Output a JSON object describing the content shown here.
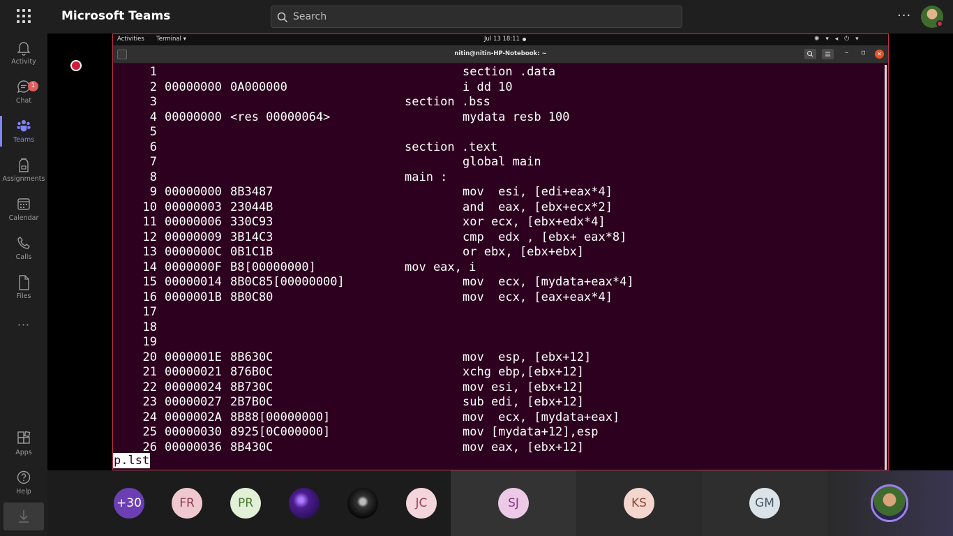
{
  "app": {
    "title": "Microsoft Teams"
  },
  "search": {
    "placeholder": "Search"
  },
  "rail": [
    {
      "label": "Activity",
      "icon": "bell-icon"
    },
    {
      "label": "Chat",
      "icon": "chat-icon",
      "badge": "1"
    },
    {
      "label": "Teams",
      "icon": "teams-icon",
      "active": true
    },
    {
      "label": "Assignments",
      "icon": "backpack-icon"
    },
    {
      "label": "Calendar",
      "icon": "calendar-icon"
    },
    {
      "label": "Calls",
      "icon": "phone-icon"
    },
    {
      "label": "Files",
      "icon": "file-icon"
    },
    {
      "label": "Apps",
      "icon": "apps-icon"
    },
    {
      "label": "Help",
      "icon": "help-icon"
    }
  ],
  "desktop": {
    "activities": "Activities",
    "app_menu": "Terminal ▾",
    "clock": "Jul 13  18:11"
  },
  "terminal": {
    "title": "nitin@nitin-HP-Notebook: ~",
    "status_line": "p.lst",
    "lines": [
      {
        "n": "1",
        "addr": "",
        "hex": "",
        "sec": "",
        "ins": "section .data"
      },
      {
        "n": "2",
        "addr": "00000000",
        "hex": "0A000000",
        "sec": "",
        "ins": "i dd 10"
      },
      {
        "n": "3",
        "addr": "",
        "hex": "",
        "sec": "section .bss",
        "ins": ""
      },
      {
        "n": "4",
        "addr": "00000000",
        "hex": "<res 00000064>",
        "sec": "",
        "ins": "mydata resb 100"
      },
      {
        "n": "5",
        "addr": "",
        "hex": "",
        "sec": "",
        "ins": ""
      },
      {
        "n": "6",
        "addr": "",
        "hex": "",
        "sec": "section .text",
        "ins": ""
      },
      {
        "n": "7",
        "addr": "",
        "hex": "",
        "sec": "",
        "ins": "global main"
      },
      {
        "n": "8",
        "addr": "",
        "hex": "",
        "sec": "main :",
        "ins": ""
      },
      {
        "n": "9",
        "addr": "00000000",
        "hex": "8B3487",
        "sec": "",
        "ins": "mov  esi, [edi+eax*4]"
      },
      {
        "n": "10",
        "addr": "00000003",
        "hex": "23044B",
        "sec": "",
        "ins": "and  eax, [ebx+ecx*2]"
      },
      {
        "n": "11",
        "addr": "00000006",
        "hex": "330C93",
        "sec": "",
        "ins": "xor ecx, [ebx+edx*4]"
      },
      {
        "n": "12",
        "addr": "00000009",
        "hex": "3B14C3",
        "sec": "",
        "ins": "cmp  edx , [ebx+ eax*8]"
      },
      {
        "n": "13",
        "addr": "0000000C",
        "hex": "0B1C1B",
        "sec": "",
        "ins": "or ebx, [ebx+ebx]"
      },
      {
        "n": "14",
        "addr": "0000000F",
        "hex": "B8[00000000]",
        "sec": "mov eax, i",
        "ins": ""
      },
      {
        "n": "15",
        "addr": "00000014",
        "hex": "8B0C85[00000000]",
        "sec": "",
        "ins": "mov  ecx, [mydata+eax*4]"
      },
      {
        "n": "16",
        "addr": "0000001B",
        "hex": "8B0C80",
        "sec": "",
        "ins": "mov  ecx, [eax+eax*4]"
      },
      {
        "n": "17",
        "addr": "",
        "hex": "",
        "sec": "",
        "ins": ""
      },
      {
        "n": "18",
        "addr": "",
        "hex": "",
        "sec": "",
        "ins": ""
      },
      {
        "n": "19",
        "addr": "",
        "hex": "",
        "sec": "",
        "ins": ""
      },
      {
        "n": "20",
        "addr": "0000001E",
        "hex": "8B630C",
        "sec": "",
        "ins": "mov  esp, [ebx+12]"
      },
      {
        "n": "21",
        "addr": "00000021",
        "hex": "876B0C",
        "sec": "",
        "ins": "xchg ebp,[ebx+12]"
      },
      {
        "n": "22",
        "addr": "00000024",
        "hex": "8B730C",
        "sec": "",
        "ins": "mov esi, [ebx+12]"
      },
      {
        "n": "23",
        "addr": "00000027",
        "hex": "2B7B0C",
        "sec": "",
        "ins": "sub edi, [ebx+12]"
      },
      {
        "n": "24",
        "addr": "0000002A",
        "hex": "8B88[00000000]",
        "sec": "",
        "ins": "mov  ecx, [mydata+eax]"
      },
      {
        "n": "25",
        "addr": "00000030",
        "hex": "8925[0C000000]",
        "sec": "",
        "ins": "mov [mydata+12],esp"
      },
      {
        "n": "26",
        "addr": "00000036",
        "hex": "8B430C",
        "sec": "",
        "ins": "mov eax, [ebx+12]"
      }
    ]
  },
  "participants": [
    {
      "initials": "+30",
      "bg": "#6b3fb3",
      "fg": "#ffffff"
    },
    {
      "initials": "FR",
      "bg": "#f0c9d0",
      "fg": "#8a3b4a"
    },
    {
      "initials": "PR",
      "bg": "#e2f0d8",
      "fg": "#4a7b2e"
    },
    {
      "initials": "",
      "bg": "#4b1d8f",
      "fg": "#ffffff",
      "photo": "purple-photo"
    },
    {
      "initials": "",
      "bg": "#111111",
      "fg": "#ffffff",
      "photo": "dark-photo"
    },
    {
      "initials": "JC",
      "bg": "#f5d5dc",
      "fg": "#9a4356"
    },
    {
      "initials": "SJ",
      "bg": "#ecc9e6",
      "fg": "#8a3a7e"
    },
    {
      "initials": "KS",
      "bg": "#f3d6cd",
      "fg": "#8a4a3a"
    },
    {
      "initials": "GM",
      "bg": "#dce3e8",
      "fg": "#4a5a68"
    },
    {
      "initials": "",
      "bg": "#3f6b2f",
      "fg": "#ffffff",
      "photo": "self-photo"
    }
  ]
}
